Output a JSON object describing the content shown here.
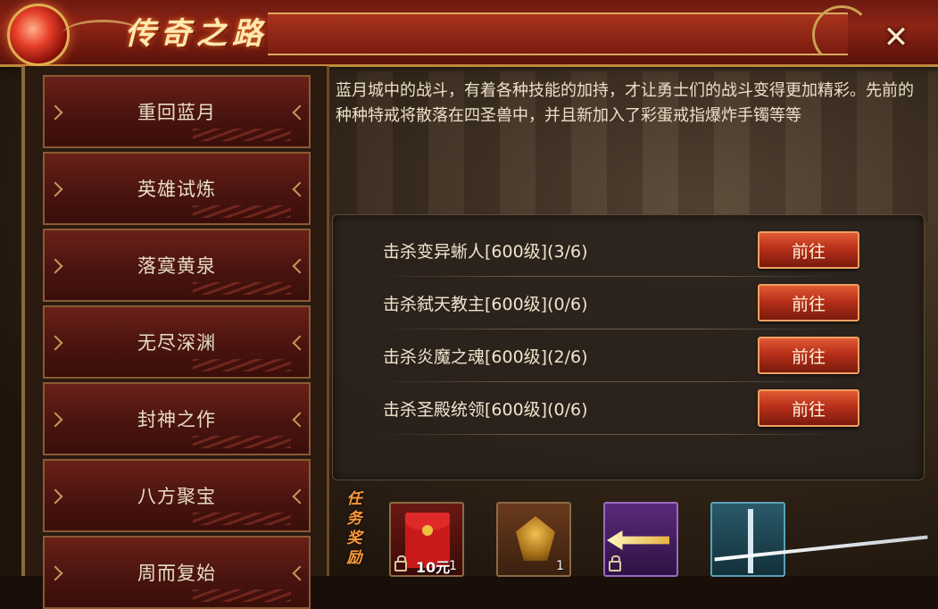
{
  "window": {
    "title": "传奇之路",
    "close_glyph": "✕"
  },
  "menu": {
    "items": [
      {
        "label": "重回蓝月"
      },
      {
        "label": "英雄试炼"
      },
      {
        "label": "落寞黄泉"
      },
      {
        "label": "无尽深渊"
      },
      {
        "label": "封神之作"
      },
      {
        "label": "八方聚宝"
      },
      {
        "label": "周而复始"
      }
    ]
  },
  "description": "蓝月城中的战斗，有着各种技能的加持，才让勇士们的战斗变得更加精彩。先前的种种特戒将散落在四圣兽中，并且新加入了彩蛋戒指爆炸手镯等等",
  "tasks": [
    {
      "label": "击杀变异蜥人[600级](3/6)",
      "button": "前往"
    },
    {
      "label": "击杀弑天教主[600级](0/6)",
      "button": "前往"
    },
    {
      "label": "击杀炎魔之魂[600级](2/6)",
      "button": "前往"
    },
    {
      "label": "击杀圣殿统领[600级](0/6)",
      "button": "前往"
    }
  ],
  "rewards": {
    "label": "任务奖励",
    "items": [
      {
        "icon": "red-envelope-icon",
        "amount": "10元",
        "count": "1",
        "locked": true
      },
      {
        "icon": "golden-beast-icon",
        "count": "1",
        "locked": false
      },
      {
        "icon": "golden-arrow-icon",
        "locked": true
      },
      {
        "icon": "staff-icon",
        "locked": false
      }
    ]
  },
  "colors": {
    "accent_gold": "#d9a860",
    "button_red": "#b8301a",
    "reward_label": "#ff9a3a"
  }
}
